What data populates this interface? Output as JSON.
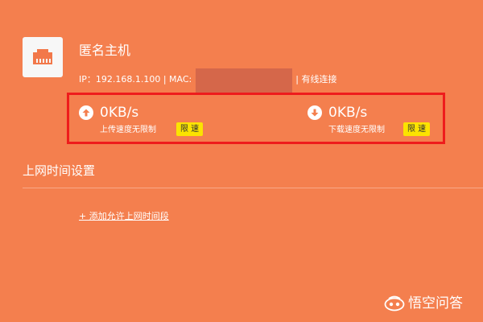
{
  "device": {
    "icon": "ethernet-port-icon",
    "name": "匿名主机",
    "ip_text": "IP：192.168.1.100 | MAC:",
    "connection_text": "| 有线连接"
  },
  "upload": {
    "icon": "upload-arrow-icon",
    "value": "0KB/s",
    "desc": "上传速度无限制",
    "limit_label": "限 速"
  },
  "download": {
    "icon": "download-arrow-icon",
    "value": "0KB/s",
    "desc": "下载速度无限制",
    "limit_label": "限 速"
  },
  "schedule": {
    "title": "上网时间设置",
    "add_link": "+ 添加允许上网时间段"
  },
  "watermark": {
    "icon": "wukong-logo-icon",
    "text": "悟空问答"
  },
  "colors": {
    "background": "#f47f4e",
    "highlight_border": "#ee1c1c",
    "limit_button": "#fbe300",
    "mac_mask": "#d5674a"
  }
}
